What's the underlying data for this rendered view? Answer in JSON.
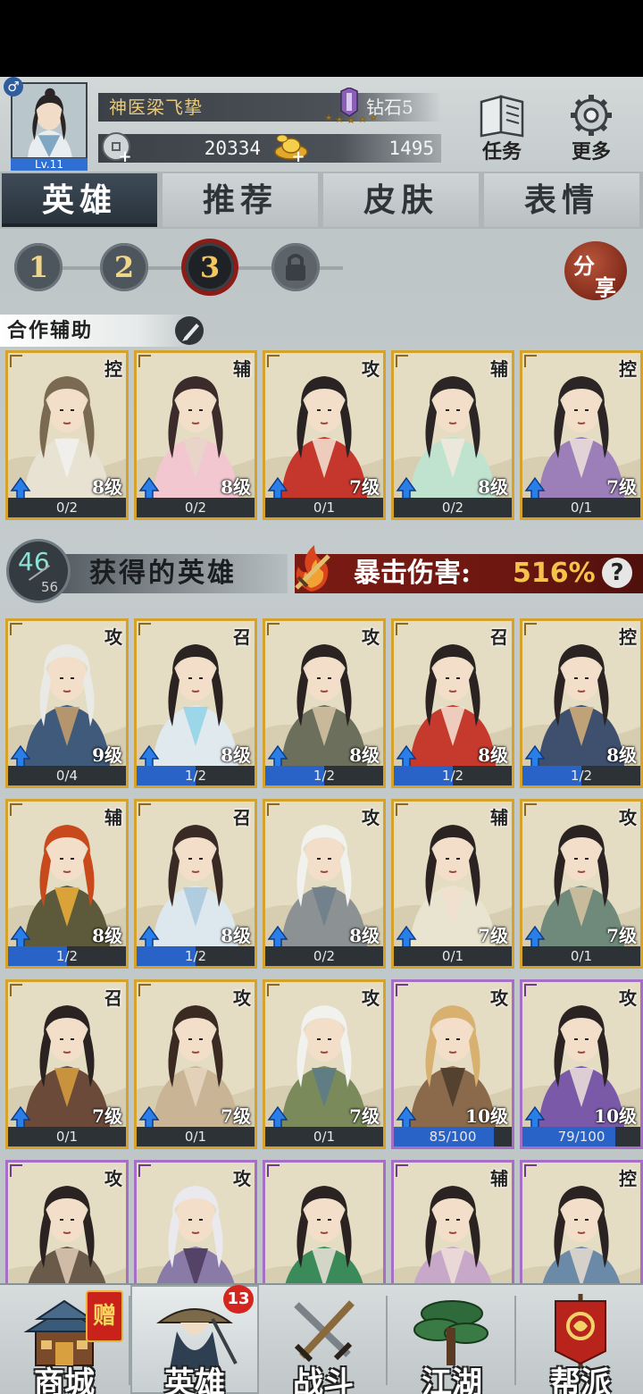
{
  "player": {
    "name": "神医梁飞挚",
    "level": "Lv.11",
    "rank": "钻石5",
    "coins": "20334",
    "gold": "1495"
  },
  "header_buttons": [
    {
      "label": "任务",
      "icon": "task-book-icon"
    },
    {
      "label": "更多",
      "icon": "gear-icon"
    }
  ],
  "tabs": [
    {
      "label": "英雄",
      "active": true
    },
    {
      "label": "推荐",
      "active": false
    },
    {
      "label": "皮肤",
      "active": false
    },
    {
      "label": "表情",
      "active": false
    }
  ],
  "pages": [
    {
      "label": "1",
      "state": "normal"
    },
    {
      "label": "2",
      "state": "normal"
    },
    {
      "label": "3",
      "state": "active"
    },
    {
      "label": "",
      "state": "locked"
    }
  ],
  "share": {
    "line1": "分",
    "line2": "享"
  },
  "coop": {
    "label": "合作辅助"
  },
  "coop_heroes": [
    {
      "role": "控",
      "level": "8级",
      "fragments": "0/2",
      "progress": 0,
      "rarity": "gold",
      "palette": [
        "#e8e2d3",
        "#7a6a52",
        "#f1f1ee"
      ]
    },
    {
      "role": "辅",
      "level": "8级",
      "fragments": "0/2",
      "progress": 0,
      "rarity": "gold",
      "palette": [
        "#f2c7d0",
        "#3b2b2b",
        "#e7d6c9"
      ]
    },
    {
      "role": "攻",
      "level": "7级",
      "fragments": "0/1",
      "progress": 0,
      "rarity": "gold",
      "palette": [
        "#c5362c",
        "#2a2323",
        "#f3e6d8"
      ]
    },
    {
      "role": "辅",
      "level": "8级",
      "fragments": "0/2",
      "progress": 0,
      "rarity": "gold",
      "palette": [
        "#bfe3cf",
        "#2b2525",
        "#f2e8dc"
      ]
    },
    {
      "role": "控",
      "level": "7级",
      "fragments": "0/1",
      "progress": 0,
      "rarity": "gold",
      "palette": [
        "#9c7fb8",
        "#2b2525",
        "#efe3da"
      ]
    }
  ],
  "owned": {
    "count": "46",
    "total": "56",
    "title": "获得的英雄",
    "crit_label": "暴击伤害:",
    "crit_value": "516%"
  },
  "owned_heroes": [
    {
      "role": "攻",
      "level": "9级",
      "fragments": "0/4",
      "progress": 0,
      "rarity": "gold",
      "palette": [
        "#3f5a7a",
        "#e9e9e6",
        "#c9a06c"
      ]
    },
    {
      "role": "召",
      "level": "8级",
      "fragments": "1/2",
      "progress": 0.5,
      "rarity": "gold",
      "palette": [
        "#dfe9ee",
        "#2a2322",
        "#8fd3e6"
      ]
    },
    {
      "role": "攻",
      "level": "8级",
      "fragments": "1/2",
      "progress": 0.5,
      "rarity": "gold",
      "palette": [
        "#6b6f5c",
        "#2a2322",
        "#d9c7a6"
      ]
    },
    {
      "role": "召",
      "level": "8级",
      "fragments": "1/2",
      "progress": 0.5,
      "rarity": "gold",
      "palette": [
        "#c53a2c",
        "#2a2322",
        "#f3e6d8"
      ]
    },
    {
      "role": "控",
      "level": "8级",
      "fragments": "1/2",
      "progress": 0.5,
      "rarity": "gold",
      "palette": [
        "#3f4f6e",
        "#2a2322",
        "#d6b07a"
      ]
    },
    {
      "role": "辅",
      "level": "8级",
      "fragments": "1/2",
      "progress": 0.5,
      "rarity": "gold",
      "palette": [
        "#5c5a3a",
        "#c84a1c",
        "#f0b03a"
      ]
    },
    {
      "role": "召",
      "level": "8级",
      "fragments": "1/2",
      "progress": 0.5,
      "rarity": "gold",
      "palette": [
        "#dde8ee",
        "#3a2a26",
        "#a8c8dc"
      ]
    },
    {
      "role": "攻",
      "level": "8级",
      "fragments": "0/2",
      "progress": 0,
      "rarity": "gold",
      "palette": [
        "#8c9294",
        "#f1f1ee",
        "#6e7e8c"
      ]
    },
    {
      "role": "辅",
      "level": "7级",
      "fragments": "0/1",
      "progress": 0,
      "rarity": "gold",
      "palette": [
        "#e9e4cf",
        "#2a2322",
        "#f0e1cd"
      ]
    },
    {
      "role": "攻",
      "level": "7级",
      "fragments": "0/1",
      "progress": 0,
      "rarity": "gold",
      "palette": [
        "#6f8a7a",
        "#2a2322",
        "#d8c3a1"
      ]
    },
    {
      "role": "召",
      "level": "7级",
      "fragments": "0/1",
      "progress": 0,
      "rarity": "gold",
      "palette": [
        "#6b4a3a",
        "#2a2322",
        "#d9a040"
      ]
    },
    {
      "role": "攻",
      "level": "7级",
      "fragments": "0/1",
      "progress": 0,
      "rarity": "gold",
      "palette": [
        "#c9b596",
        "#3a2a22",
        "#e8d6bf"
      ]
    },
    {
      "role": "攻",
      "level": "7级",
      "fragments": "0/1",
      "progress": 0,
      "rarity": "gold",
      "palette": [
        "#7a8a5a",
        "#f1f1ee",
        "#5a7a8a"
      ]
    },
    {
      "role": "攻",
      "level": "10级",
      "fragments": "85/100",
      "progress": 0.85,
      "rarity": "purple",
      "palette": [
        "#8a6a4a",
        "#d8b070",
        "#4a3a2a"
      ]
    },
    {
      "role": "攻",
      "level": "10级",
      "fragments": "79/100",
      "progress": 0.79,
      "rarity": "purple",
      "palette": [
        "#7a5aa8",
        "#2a2322",
        "#efe3da"
      ]
    },
    {
      "role": "攻",
      "level": "",
      "fragments": "",
      "progress": 0,
      "rarity": "purple",
      "palette": [
        "#6a5a4a",
        "#2a2322",
        "#e0cdb6"
      ]
    },
    {
      "role": "攻",
      "level": "",
      "fragments": "",
      "progress": 0,
      "rarity": "purple",
      "palette": [
        "#8a7aa8",
        "#e9e9ee",
        "#4a3a5a"
      ]
    },
    {
      "role": "",
      "level": "",
      "fragments": "",
      "progress": 0,
      "rarity": "purple",
      "palette": [
        "#3a8a5a",
        "#2a2322",
        "#efe3da"
      ]
    },
    {
      "role": "辅",
      "level": "",
      "fragments": "",
      "progress": 0,
      "rarity": "purple",
      "palette": [
        "#c8a8c8",
        "#2a2322",
        "#f0e1d8"
      ]
    },
    {
      "role": "控",
      "level": "",
      "fragments": "",
      "progress": 0,
      "rarity": "purple",
      "palette": [
        "#6a8aa8",
        "#2a2322",
        "#e8dccf"
      ]
    }
  ],
  "nav": [
    {
      "label": "商城",
      "icon": "shop-building-icon",
      "active": false
    },
    {
      "label": "英雄",
      "icon": "hero-straw-hat-icon",
      "active": true
    },
    {
      "label": "战斗",
      "icon": "crossed-swords-icon",
      "active": false
    },
    {
      "label": "江湖",
      "icon": "pine-tree-icon",
      "active": false
    },
    {
      "label": "帮派",
      "icon": "clan-banner-icon",
      "active": false
    }
  ],
  "nav_extras": {
    "gift_label": "赠",
    "hero_badge": "13"
  },
  "colors": {
    "gold_border": "#d5a22c",
    "purple_border": "#a46fc4",
    "progress_blue": "#2a63c7",
    "crit_red": "#7b1a14"
  }
}
